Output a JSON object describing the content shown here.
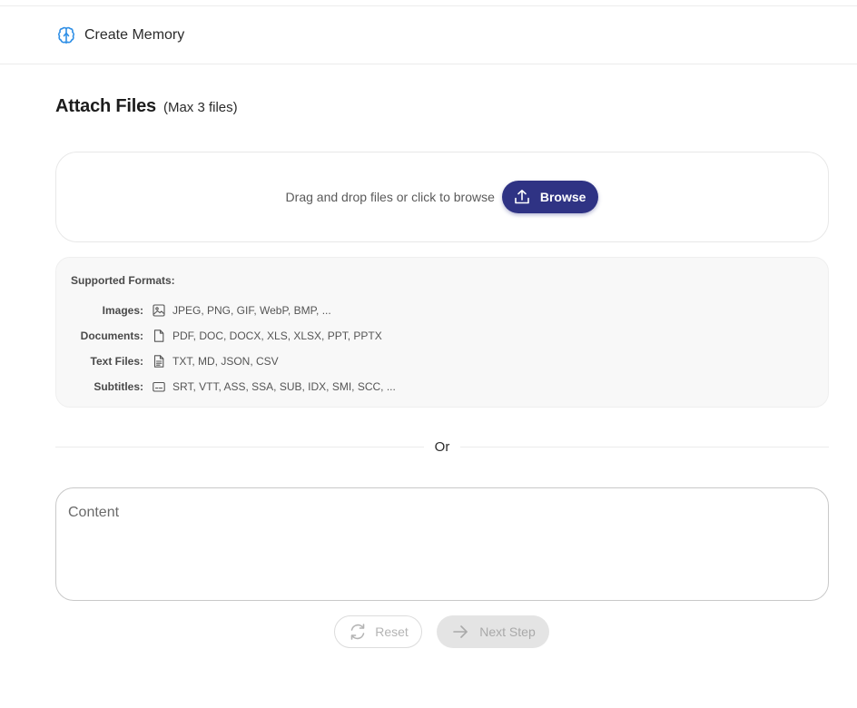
{
  "header": {
    "icon": "brain-icon",
    "title": "Create Memory"
  },
  "attach": {
    "heading": "Attach Files",
    "max": "(Max 3 files)"
  },
  "dropzone": {
    "hint": "Drag and drop files or click to browse",
    "browse_label": "Browse",
    "browse_icon": "upload-icon"
  },
  "formats": {
    "title": "Supported Formats:",
    "rows": [
      {
        "label": "Images:",
        "icon": "image-icon",
        "value": "JPEG, PNG, GIF, WebP, BMP, ..."
      },
      {
        "label": "Documents:",
        "icon": "document-icon",
        "value": "PDF, DOC, DOCX, XLS, XLSX, PPT, PPTX"
      },
      {
        "label": "Text Files:",
        "icon": "text-file-icon",
        "value": "TXT, MD, JSON, CSV"
      },
      {
        "label": "Subtitles:",
        "icon": "subtitles-icon",
        "value": "SRT, VTT, ASS, SSA, SUB, IDX, SMI, SCC, ..."
      }
    ]
  },
  "divider": {
    "label": "Or"
  },
  "content": {
    "placeholder": "Content",
    "value": ""
  },
  "actions": {
    "reset_label": "Reset",
    "next_label": "Next Step"
  },
  "colors": {
    "accent": "#2f3384",
    "brand_icon": "#2f8fe6",
    "disabled_bg": "#e4e4e4"
  }
}
